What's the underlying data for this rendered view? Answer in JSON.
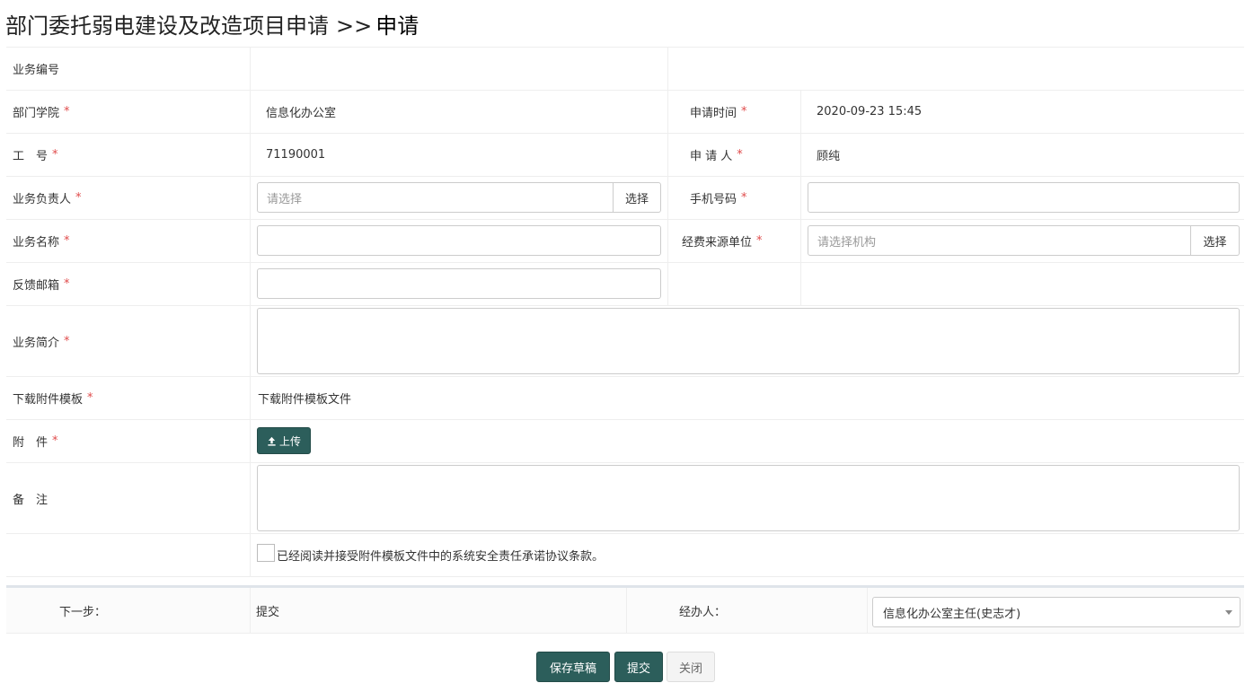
{
  "page": {
    "title": "部门委托弱电建设及改造项目申请",
    "sep": ">>",
    "title_suffix": "申请"
  },
  "form": {
    "business_no": {
      "label": "业务编号",
      "value": ""
    },
    "department": {
      "label": "部门学院",
      "required": "*",
      "value": "信息化办公室"
    },
    "apply_time": {
      "label": "申请时间",
      "required": "*",
      "value": "2020-09-23 15:45"
    },
    "staff_no": {
      "label": "工　号",
      "required": "*",
      "value": "71190001"
    },
    "applicant": {
      "label": "申 请 人",
      "required": "*",
      "value": "顾纯"
    },
    "owner": {
      "label": "业务负责人",
      "required": "*",
      "placeholder": "请选择",
      "button": "选择"
    },
    "phone": {
      "label": "手机号码",
      "required": "*",
      "value": ""
    },
    "business_name": {
      "label": "业务名称",
      "required": "*",
      "value": ""
    },
    "funding_unit": {
      "label": "经费来源单位",
      "required": "*",
      "placeholder": "请选择机构",
      "button": "选择"
    },
    "feedback_email": {
      "label": "反馈邮箱",
      "required": "*",
      "value": ""
    },
    "summary": {
      "label": "业务简介",
      "required": "*",
      "value": ""
    },
    "template": {
      "label": "下载附件模板",
      "required": "*",
      "link": "下载附件模板文件"
    },
    "attachment": {
      "label": "附　件",
      "required": "*",
      "button": "上传",
      "icon": "upload-icon"
    },
    "remark": {
      "label": "备　注",
      "value": ""
    },
    "agreement": {
      "text": "已经阅读并接受附件模板文件中的系统安全责任承诺协议条款。",
      "checked": false
    }
  },
  "workflow": {
    "next_label": "下一步：",
    "next_value": "提交",
    "handler_label": "经办人：",
    "handler_value": "信息化办公室主任(史志才)"
  },
  "actions": {
    "save_draft": "保存草稿",
    "submit": "提交",
    "close": "关闭"
  },
  "colors": {
    "primary": "#2c5e5b",
    "required": "#e04b4b",
    "border": "#cccccc"
  }
}
